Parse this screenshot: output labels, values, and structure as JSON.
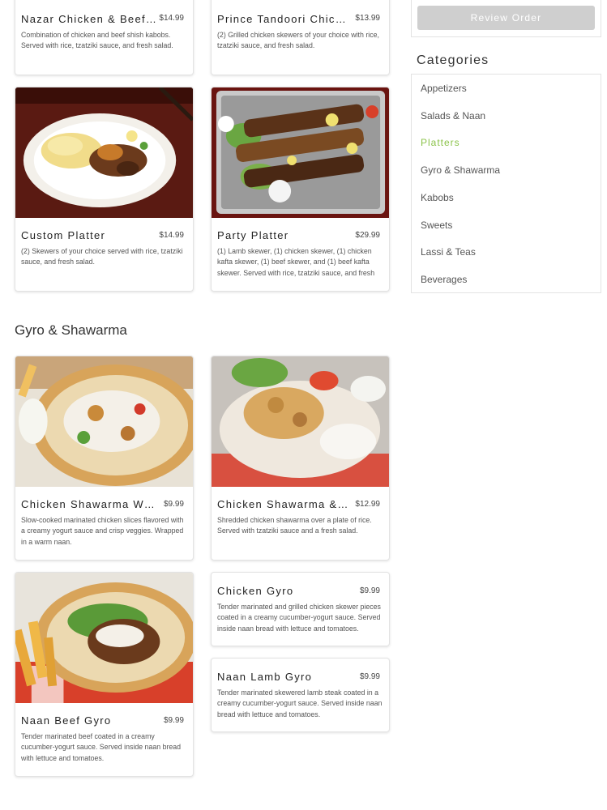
{
  "menu": {
    "items": [
      {
        "title": "Nazar Chicken & Beef Platter",
        "price": "$14.99",
        "description": "Combination of chicken and beef shish kabobs. Served with rice, tzatziki sauce, and fresh salad."
      },
      {
        "title": "Prince Tandoori Chicken Platter",
        "price": "$13.99",
        "description": "(2) Grilled chicken skewers of your choice with rice, tzatziki sauce, and fresh salad."
      },
      {
        "title": "Custom Platter",
        "price": "$14.99",
        "description": "(2) Skewers of your choice served with rice, tzatziki sauce, and fresh salad."
      },
      {
        "title": "Party Platter",
        "price": "$29.99",
        "description": "(1) Lamb skewer, (1) chicken skewer, (1) chicken kafta skewer, (1) beef skewer, and (1) beef kafta skewer. Served with rice, tzatziki sauce, and fresh salad."
      }
    ],
    "section_title": "Gyro & Shawarma",
    "gyro_items": [
      {
        "title": "Chicken Shawarma Wrap",
        "price": "$9.99",
        "description": "Slow-cooked marinated chicken slices flavored with a creamy yogurt sauce and crisp veggies. Wrapped in a warm naan."
      },
      {
        "title": "Chicken Shawarma & Rice",
        "price": "$12.99",
        "description": "Shredded chicken shawarma over a plate of rice. Served with tzatziki sauce and a fresh salad."
      },
      {
        "title": "Chicken Gyro",
        "price": "$9.99",
        "description": "Tender marinated and grilled chicken skewer pieces coated in a creamy cucumber-yogurt sauce. Served inside naan bread with lettuce and tomatoes."
      },
      {
        "title": "Naan Lamb Gyro",
        "price": "$9.99",
        "description": "Tender marinated skewered lamb steak coated in a creamy cucumber-yogurt sauce. Served inside naan bread with lettuce and tomatoes."
      },
      {
        "title": "Naan Beef Gyro",
        "price": "$9.99",
        "description": "Tender marinated beef coated in a creamy cucumber-yogurt sauce. Served inside naan bread with lettuce and tomatoes."
      }
    ]
  },
  "sidebar": {
    "review_order_label": "Review Order",
    "categories_heading": "Categories",
    "categories": [
      "Appetizers",
      "Salads & Naan",
      "Platters",
      "Gyro & Shawarma",
      "Kabobs",
      "Sweets",
      "Lassi & Teas",
      "Beverages"
    ],
    "active_category": "Platters",
    "active_color": "#8bc34a"
  }
}
